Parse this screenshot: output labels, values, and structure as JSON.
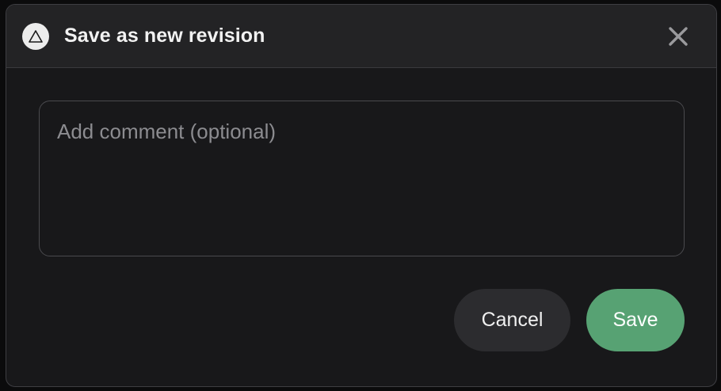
{
  "dialog": {
    "title": "Save as new revision",
    "logo_icon": "triangle-icon",
    "close_icon": "close-icon"
  },
  "comment": {
    "placeholder": "Add comment (optional)",
    "value": ""
  },
  "actions": {
    "cancel_label": "Cancel",
    "save_label": "Save"
  },
  "colors": {
    "background": "#18181a",
    "header": "#232325",
    "save_button": "#57a273",
    "cancel_button": "#2c2c2f"
  }
}
